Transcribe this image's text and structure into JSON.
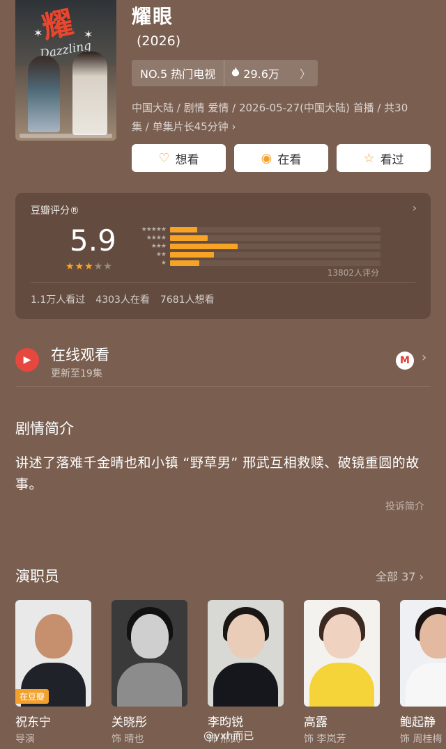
{
  "header": {
    "title": "耀眼",
    "year": "(2026)",
    "rank_label": "NO.5 热门电视",
    "heat_value": "29.6万",
    "meta_line1": "中国大陆 / 剧情 爱情 / 2026-05-27(中国大陆) 首播 / 共30",
    "meta_line2": "集 / 单集片长45分钟",
    "poster_title_art": "耀",
    "poster_brand": "Dazzling"
  },
  "actions": {
    "want_label": "想看",
    "watching_label": "在看",
    "watched_label": "看过"
  },
  "rating": {
    "title": "豆瓣评分®",
    "score": "5.9",
    "stars_filled": 3,
    "distribution": [
      0.13,
      0.18,
      0.32,
      0.21,
      0.14
    ],
    "count_label": "13802人评分",
    "watched_stat": "1.1万人看过",
    "watching_stat": "4303人在看",
    "want_stat": "7681人想看"
  },
  "online": {
    "title": "在线观看",
    "subtitle": "更新至19集",
    "platform_icon": "M"
  },
  "synopsis": {
    "heading": "剧情简介",
    "body": "讲述了落难千金晴也和小镇 “野草男” 邢武互相救赎、破镜重圆的故事。",
    "report_label": "投诉简介"
  },
  "cast": {
    "heading": "演职员",
    "all_label": "全部 37",
    "members": [
      {
        "name": "祝东宁",
        "role": "导演",
        "tag": "在豆瓣"
      },
      {
        "name": "关晓彤",
        "role": "饰 晴也",
        "tag": ""
      },
      {
        "name": "李昀锐",
        "role": "饰 邢武",
        "tag": ""
      },
      {
        "name": "高露",
        "role": "饰 李岚芳",
        "tag": ""
      },
      {
        "name": "鲍起静",
        "role": "饰 周桂梅",
        "tag": ""
      }
    ]
  },
  "watermark": "@yxh而已",
  "colors": {
    "background": "#7a5f50",
    "accent": "#f7a426",
    "play_red": "#e6473e"
  }
}
